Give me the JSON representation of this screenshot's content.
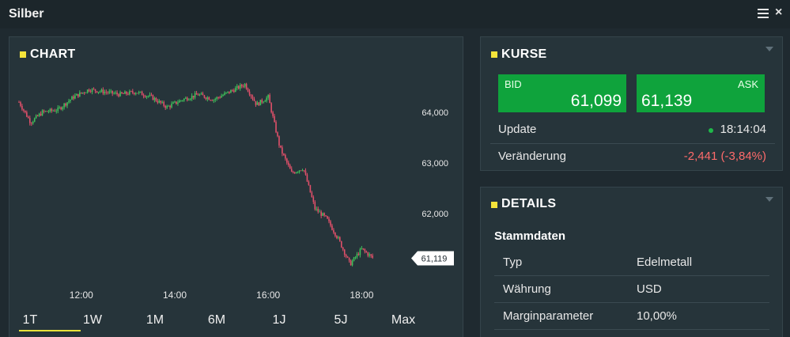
{
  "window": {
    "title": "Silber"
  },
  "icons": {
    "menu": "hamburger-menu-icon",
    "close": "close-icon",
    "status": "status-dot-icon"
  },
  "colors": {
    "accent": "#f5e43a",
    "bid_ask_bg": "#0fa33c",
    "negative": "#ff6b6b",
    "background": "#1f2a30"
  },
  "chart": {
    "title": "CHART",
    "y_ticks": [
      "64,000",
      "63,000",
      "62,000"
    ],
    "x_ticks": [
      "12:00",
      "14:00",
      "16:00",
      "18:00"
    ],
    "last_price_label": "61,119",
    "ranges": [
      "1T",
      "1W",
      "1M",
      "6M",
      "1J",
      "5J",
      "Max"
    ],
    "selected_range": "1T"
  },
  "chart_data": {
    "type": "candlestick",
    "x_unit": "time",
    "x_range": [
      "10:40",
      "18:25"
    ],
    "ylim": [
      60800,
      64700
    ],
    "y_ticks": [
      64000,
      63000,
      62000
    ],
    "x_ticks": [
      "12:00",
      "14:00",
      "16:00",
      "18:00"
    ],
    "close_series": [
      {
        "t": "10:40",
        "v": 64200
      },
      {
        "t": "10:55",
        "v": 63800
      },
      {
        "t": "11:10",
        "v": 64000
      },
      {
        "t": "11:30",
        "v": 64050
      },
      {
        "t": "11:50",
        "v": 64300
      },
      {
        "t": "12:10",
        "v": 64450
      },
      {
        "t": "12:30",
        "v": 64400
      },
      {
        "t": "12:50",
        "v": 64350
      },
      {
        "t": "13:10",
        "v": 64400
      },
      {
        "t": "13:30",
        "v": 64300
      },
      {
        "t": "13:50",
        "v": 64100
      },
      {
        "t": "14:10",
        "v": 64250
      },
      {
        "t": "14:30",
        "v": 64350
      },
      {
        "t": "14:50",
        "v": 64250
      },
      {
        "t": "15:10",
        "v": 64400
      },
      {
        "t": "15:30",
        "v": 64550
      },
      {
        "t": "15:45",
        "v": 64150
      },
      {
        "t": "16:00",
        "v": 64300
      },
      {
        "t": "16:15",
        "v": 63300
      },
      {
        "t": "16:30",
        "v": 62800
      },
      {
        "t": "16:45",
        "v": 62900
      },
      {
        "t": "17:00",
        "v": 62100
      },
      {
        "t": "17:15",
        "v": 61900
      },
      {
        "t": "17:30",
        "v": 61500
      },
      {
        "t": "17:45",
        "v": 61000
      },
      {
        "t": "18:00",
        "v": 61300
      },
      {
        "t": "18:15",
        "v": 61119
      }
    ],
    "last_value": 61119
  },
  "kurse": {
    "title": "KURSE",
    "bid_label": "BID",
    "bid_value": "61,099",
    "ask_label": "ASK",
    "ask_value": "61,139",
    "update_label": "Update",
    "update_time": "18:14:04",
    "change_label": "Veränderung",
    "change_value": "-2,441 (-3,84%)"
  },
  "details": {
    "title": "DETAILS",
    "section": "Stammdaten",
    "rows": [
      {
        "key": "Typ",
        "value": "Edelmetall"
      },
      {
        "key": "Währung",
        "value": "USD"
      },
      {
        "key": "Marginparameter",
        "value": "10,00%"
      }
    ]
  }
}
